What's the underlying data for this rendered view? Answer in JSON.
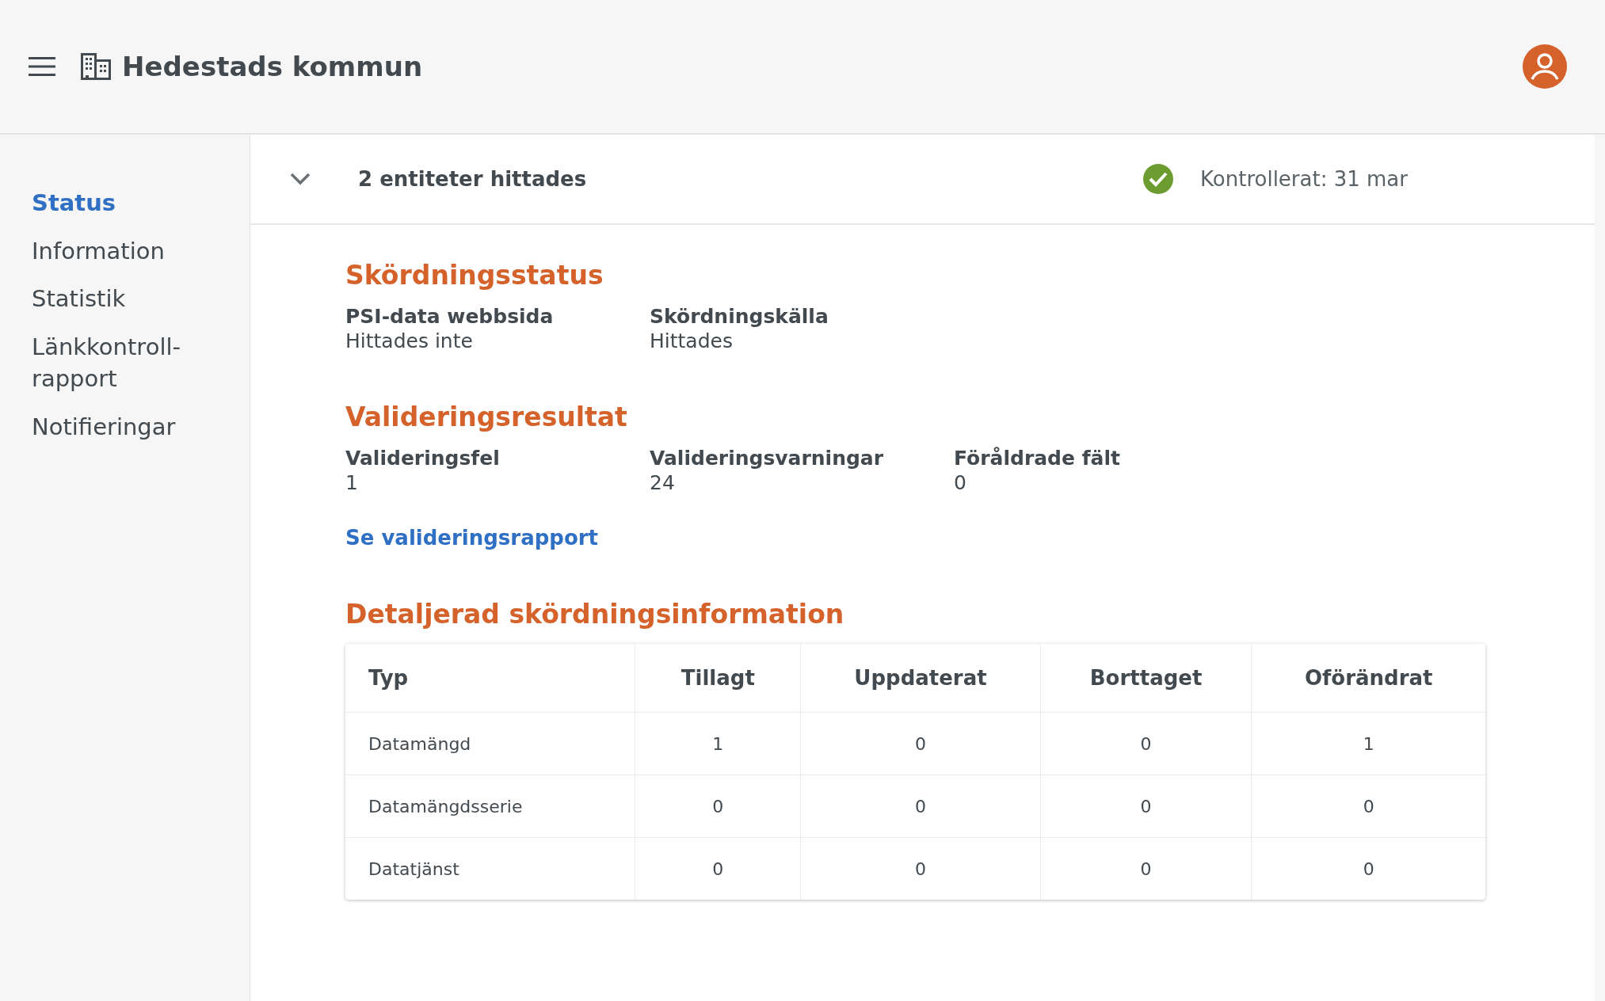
{
  "header": {
    "title": "Hedestads kommun"
  },
  "sidebar": {
    "items": [
      {
        "label": "Status",
        "selected": true
      },
      {
        "label": "Information",
        "selected": false
      },
      {
        "label": "Statistik",
        "selected": false
      },
      {
        "label": "Länkkontroll-\nrapport",
        "selected": false
      },
      {
        "label": "Notifieringar",
        "selected": false
      }
    ]
  },
  "summary": {
    "title": "2 entiteter hittades",
    "expanded": true,
    "checked_label": "Kontrollerat: 31 mar"
  },
  "sections": [
    {
      "heading": "Skördningsstatus",
      "fields": [
        {
          "label": "PSI-data webbsida",
          "value": "Hittades inte"
        },
        {
          "label": "Skördningskälla",
          "value": "Hittades"
        }
      ]
    },
    {
      "heading": "Valideringsresultat",
      "fields": [
        {
          "label": "Valideringsfel",
          "value": "1"
        },
        {
          "label": "Valideringsvarningar",
          "value": "24"
        },
        {
          "label": "Föråldrade fält",
          "value": "0"
        }
      ],
      "link": "Se valideringsrapport"
    }
  ],
  "details": {
    "heading": "Detaljerad skördningsinformation",
    "table": {
      "columns": [
        "Typ",
        "Tillagt",
        "Uppdaterat",
        "Borttaget",
        "Oförändrat"
      ],
      "rows": [
        [
          "Datamängd",
          "1",
          "0",
          "0",
          "1"
        ],
        [
          "Datamängdsserie",
          "0",
          "0",
          "0",
          "0"
        ],
        [
          "Datatjänst",
          "0",
          "0",
          "0",
          "0"
        ]
      ]
    }
  }
}
